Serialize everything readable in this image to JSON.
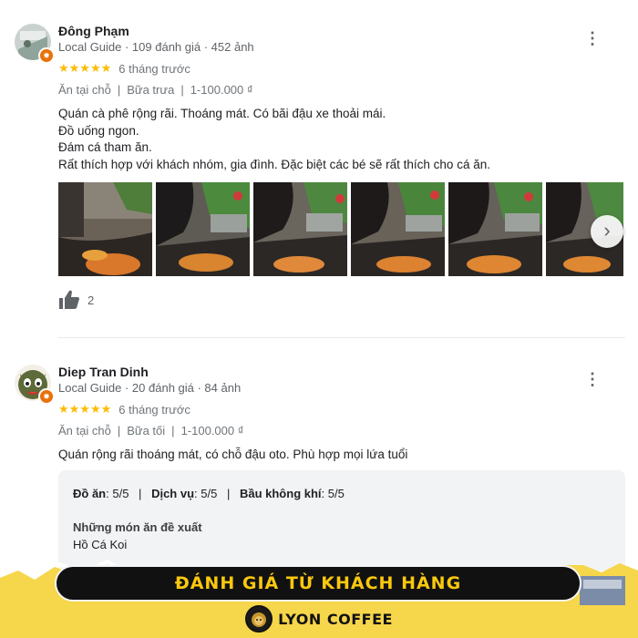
{
  "reviews": [
    {
      "author": "Đông Phạm",
      "meta": "Local Guide · 109 đánh giá · 452 ảnh",
      "stars": "★★★★★",
      "rating": 5,
      "time": "6 tháng trước",
      "tags": [
        "Ăn tại chỗ",
        "Bữa trưa",
        "1-100.000 ₫"
      ],
      "text_lines": [
        "Quán cà phê rộng rãi. Thoáng mát. Có bãi đậu xe thoải mái.",
        "Đồ uống ngon.",
        "Đám cá tham ăn.",
        "Rất thích hợp với khách nhóm, gia đình. Đặc biệt các bé sẽ rất thích cho cá ăn."
      ],
      "like_count": "2"
    },
    {
      "author": "Diep Tran Dinh",
      "meta": "Local Guide · 20 đánh giá · 84 ảnh",
      "stars": "★★★★★",
      "rating": 5,
      "time": "6 tháng trước",
      "tags": [
        "Ăn tại chỗ",
        "Bữa tối",
        "1-100.000 ₫"
      ],
      "text_lines": [
        "Quán rộng rãi thoáng mát, có chỗ đậu oto. Phù hợp mọi lứa tuổi"
      ],
      "scores": [
        {
          "label": "Đồ ăn",
          "value": ": 5/5"
        },
        {
          "label": "Dịch vụ",
          "value": ": 5/5"
        },
        {
          "label": "Bầu không khí",
          "value": ": 5/5"
        }
      ],
      "recommended_heading": "Những món ăn đề xuất",
      "recommended_item": "Hồ Cá Koi"
    }
  ],
  "banner": {
    "title": "ĐÁNH GIÁ TỪ KHÁCH HÀNG",
    "brand": "LYON COFFEE"
  },
  "colors": {
    "star": "#fbbc04",
    "banner_text": "#f9c80e",
    "torn_paper": "#f6d64a"
  },
  "icons": {
    "more": "more-vert-icon",
    "like": "thumb-up-icon",
    "next": "chevron-right-icon"
  }
}
